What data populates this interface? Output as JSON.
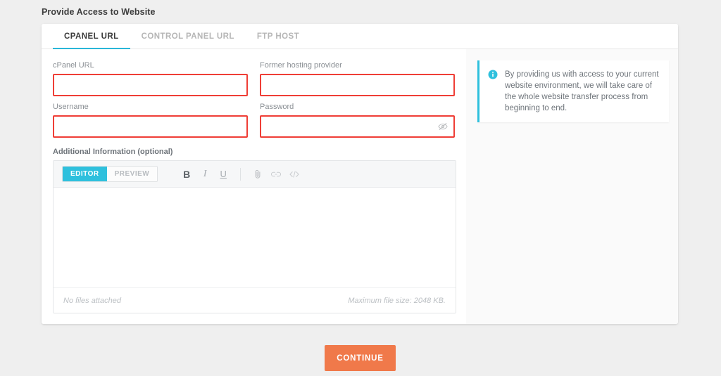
{
  "page": {
    "title": "Provide Access to Website",
    "background_color": "#efefef"
  },
  "colors": {
    "accent_cyan": "#2ec0dd",
    "tab_underline": "#29b6d8",
    "error_border": "#ef3e36",
    "continue_orange": "#f0794a"
  },
  "tabs": [
    {
      "label": "CPANEL URL",
      "active": true
    },
    {
      "label": "CONTROL PANEL URL",
      "active": false
    },
    {
      "label": "FTP HOST",
      "active": false
    }
  ],
  "form": {
    "cpanel_url": {
      "label": "cPanel URL",
      "value": "",
      "placeholder": "",
      "invalid": true
    },
    "former_hosting_provider": {
      "label": "Former hosting provider",
      "value": "",
      "placeholder": "",
      "invalid": true
    },
    "username": {
      "label": "Username",
      "value": "",
      "placeholder": "",
      "invalid": true
    },
    "password": {
      "label": "Password",
      "value": "",
      "placeholder": "",
      "invalid": true,
      "toggle_icon": "eye-slash-icon"
    }
  },
  "additional_information": {
    "label": "Additional Information (optional)",
    "toolbar": {
      "editor_label": "EDITOR",
      "preview_label": "PREVIEW",
      "active_mode": "EDITOR",
      "bold_label": "B",
      "italic_label": "I",
      "underline_label": "U",
      "attach_icon": "paperclip-icon",
      "link_icon": "link-icon",
      "code_icon": "code-icon"
    },
    "body_value": "",
    "footer": {
      "attachments_status": "No files attached",
      "max_file_size": "Maximum file size: 2048 KB."
    }
  },
  "info_panel": {
    "icon": "info-circle-icon",
    "text": "By providing us with access to your current website environment, we will take care of the whole website transfer process from beginning to end."
  },
  "actions": {
    "continue_label": "CONTINUE"
  }
}
